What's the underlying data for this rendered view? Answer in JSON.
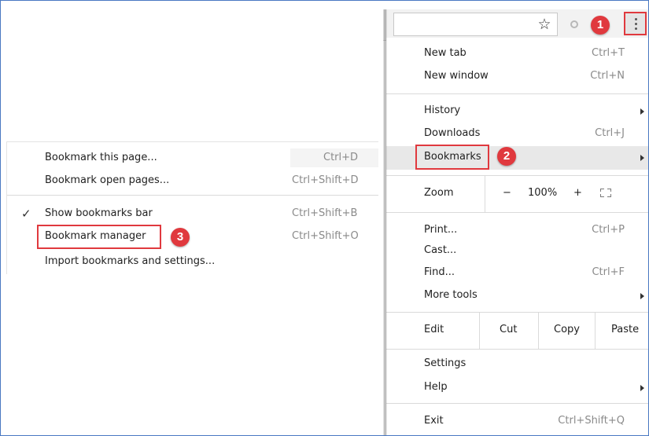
{
  "toolbar": {
    "icons": [
      "star-icon",
      "extension-icon",
      "menu-kebab-icon"
    ]
  },
  "callouts": {
    "one": "1",
    "two": "2",
    "three": "3"
  },
  "accent_color": "#e0393e",
  "menu": {
    "new_tab": {
      "label": "New tab",
      "shortcut": "Ctrl+T"
    },
    "new_window": {
      "label": "New window",
      "shortcut": "Ctrl+N"
    },
    "history": {
      "label": "History"
    },
    "downloads": {
      "label": "Downloads",
      "shortcut": "Ctrl+J"
    },
    "bookmarks": {
      "label": "Bookmarks"
    },
    "zoom": {
      "label": "Zoom",
      "minus": "−",
      "level": "100%",
      "plus": "+"
    },
    "print": {
      "label": "Print...",
      "shortcut": "Ctrl+P"
    },
    "cast": {
      "label": "Cast..."
    },
    "find": {
      "label": "Find...",
      "shortcut": "Ctrl+F"
    },
    "more_tools": {
      "label": "More tools"
    },
    "edit": {
      "label": "Edit",
      "cut": "Cut",
      "copy": "Copy",
      "paste": "Paste"
    },
    "settings": {
      "label": "Settings"
    },
    "help": {
      "label": "Help"
    },
    "exit": {
      "label": "Exit",
      "shortcut": "Ctrl+Shift+Q"
    }
  },
  "submenu": {
    "bookmark_page": {
      "label": "Bookmark this page...",
      "shortcut": "Ctrl+D"
    },
    "bookmark_open_pages": {
      "label": "Bookmark open pages...",
      "shortcut": "Ctrl+Shift+D"
    },
    "show_bar": {
      "label": "Show bookmarks bar",
      "shortcut": "Ctrl+Shift+B",
      "checked": true
    },
    "manager": {
      "label": "Bookmark manager",
      "shortcut": "Ctrl+Shift+O"
    },
    "import": {
      "label": "Import bookmarks and settings..."
    }
  }
}
